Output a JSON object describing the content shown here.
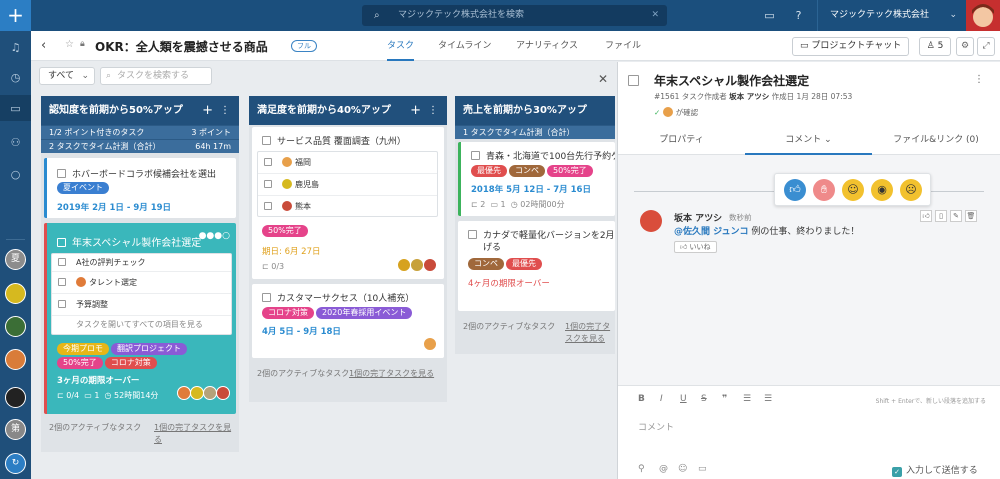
{
  "topbar": {
    "search_placeholder": "マジックテック株式会社を検索",
    "company": "マジックテック株式会社",
    "plus_icon": "plus-icon"
  },
  "project": {
    "title": "OKR：全人類を震撼させる商品",
    "badge": "フル",
    "tabs": [
      {
        "label": "タスク",
        "active": true
      },
      {
        "label": "タイムライン",
        "active": false
      },
      {
        "label": "アナリティクス",
        "active": false
      },
      {
        "label": "ファイル",
        "active": false
      }
    ],
    "chat_button": "プロジェクトチャット",
    "member_count": "5"
  },
  "filter": {
    "select": "すべて",
    "search_placeholder": "タスクを検索する"
  },
  "columns": [
    {
      "title": "認知度を前期から50%アップ",
      "sub1_left": "1/2 ポイント付きのタスク",
      "sub1_right": "3 ポイント",
      "sub2_left": "2 タスクでタイム計測（合計）",
      "sub2_right": "64h 17m",
      "card1": {
        "title": "ホバーボードコラボ候補会社を選出",
        "tag": "夏イベント",
        "date": "2019年 2月 1日 - 9月 19日"
      },
      "card2": {
        "title": "年末スペシャル製作会社選定",
        "checklist": [
          "A社の評判チェック",
          "タレント選定",
          "予算調整"
        ],
        "checklist_more": "タスクを開いてすべての項目を見る",
        "tags": [
          "今期プロモ",
          "翻訳プロジェクト",
          "50%完了",
          "コロナ対策"
        ],
        "overdue": "3ヶ月の期限オーバー",
        "subtasks": "0/4",
        "comments": "1",
        "time": "52時間14分"
      },
      "foot_left": "2個のアクティブなタスク",
      "foot_right": "1個の完了タスクを見る"
    },
    {
      "title": "満足度を前期から40%アップ",
      "card1": {
        "title": "サービス品質 覆面調査（九州）",
        "checklist": [
          "福岡",
          "鹿児島",
          "熊本"
        ],
        "tag": "50%完了",
        "due": "期日: 6月 27日",
        "subtasks": "0/3"
      },
      "card2": {
        "title": "カスタマーサクセス（10人補充）",
        "tags": [
          "コロナ対策",
          "2020年春採用イベント"
        ],
        "date": "4月 5日 - 9月 18日"
      },
      "foot_left": "2個のアクティブなタスク",
      "foot_right": "1個の完了タスクを見る"
    },
    {
      "title": "売上を前期から30%アップ",
      "sub1_left": "1 タスクでタイム計測（合計）",
      "card1": {
        "title": "青森・北海道で100台先行予約ゲ",
        "tags": [
          "最優先",
          "コンペ",
          "50%完了"
        ],
        "date": "2018年 5月 12日 - 7月 16日",
        "subtasks": "2",
        "comments": "1",
        "time": "02時間00分"
      },
      "card2": {
        "title": "カナダで軽量化バージョンを2月に",
        "title2": "げる",
        "tags": [
          "コンペ",
          "最優先"
        ],
        "overdue": "4ヶ月の期限オーバー"
      },
      "foot_left": "2個のアクティブなタスク",
      "foot_right": "1個の完了タスクを見る"
    }
  ],
  "panel": {
    "title": "年末スペシャル製作会社選定",
    "meta_id": "#1561",
    "meta_created_by": "タスク作成者",
    "meta_author": "坂本 アツシ",
    "meta_date": "作成日 1月 28日 07:53",
    "confirmed": "が確認",
    "tabs": [
      "プロパティ",
      "コメント",
      "ファイル&リンク (0)"
    ],
    "comment": {
      "author": "坂本 アツシ",
      "time": "数秒前",
      "mention": "@佐久間 ジュンコ",
      "text": " 例の仕事、終わりました！",
      "like": "いいね"
    },
    "editor": {
      "hint": "Shift + Enterで、新しい段落を追加する",
      "placeholder": "コメント",
      "enter_to_send": "入力して送信する"
    }
  },
  "colors": {
    "topbar": "#1b4f7d",
    "column_header": "#21507c",
    "accent": "#2878be",
    "teal_card": "#3ab7bb",
    "tag_yellow": "#e7b617",
    "tag_purple": "#8a5bd6",
    "tag_pink": "#e5438a",
    "tag_red": "#e04e4e",
    "tag_brown": "#a0683b",
    "tag_blue": "#3a7fd1"
  }
}
